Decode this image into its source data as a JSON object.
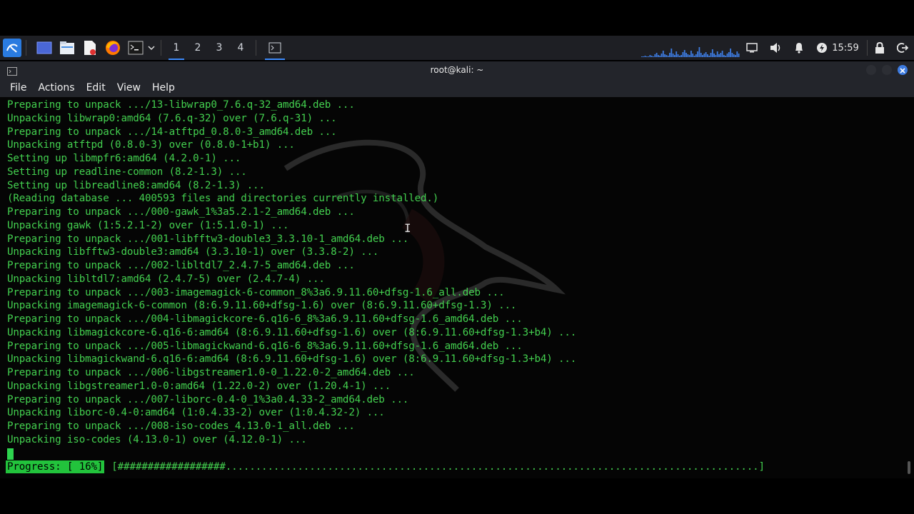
{
  "taskbar": {
    "workspaces": [
      "1",
      "2",
      "3",
      "4"
    ],
    "active_workspace": "1",
    "clock": "15:59",
    "icons": [
      "kali-menu-icon",
      "desktop-icon",
      "file-manager-icon",
      "text-editor-icon",
      "firefox-icon",
      "terminal-icon",
      "dropdown-chevron-icon",
      "terminal-task-icon",
      "cpu-graph",
      "display-icon",
      "volume-icon",
      "notification-bell-icon",
      "power-manager-icon",
      "lock-icon",
      "logout-icon"
    ]
  },
  "window": {
    "title": "root@kali: ~",
    "menu": [
      "File",
      "Actions",
      "Edit",
      "View",
      "Help"
    ]
  },
  "terminal": {
    "lines": [
      "Preparing to unpack .../13-libwrap0_7.6.q-32_amd64.deb ...",
      "Unpacking libwrap0:amd64 (7.6.q-32) over (7.6.q-31) ...",
      "Preparing to unpack .../14-atftpd_0.8.0-3_amd64.deb ...",
      "Unpacking atftpd (0.8.0-3) over (0.8.0-1+b1) ...",
      "Setting up libmpfr6:amd64 (4.2.0-1) ...",
      "Setting up readline-common (8.2-1.3) ...",
      "Setting up libreadline8:amd64 (8.2-1.3) ...",
      "(Reading database ... 400593 files and directories currently installed.)",
      "Preparing to unpack .../000-gawk_1%3a5.2.1-2_amd64.deb ...",
      "Unpacking gawk (1:5.2.1-2) over (1:5.1.0-1) ...",
      "Preparing to unpack .../001-libfftw3-double3_3.3.10-1_amd64.deb ...",
      "Unpacking libfftw3-double3:amd64 (3.3.10-1) over (3.3.8-2) ...",
      "Preparing to unpack .../002-libltdl7_2.4.7-5_amd64.deb ...",
      "Unpacking libltdl7:amd64 (2.4.7-5) over (2.4.7-4) ...",
      "Preparing to unpack .../003-imagemagick-6-common_8%3a6.9.11.60+dfsg-1.6_all.deb ...",
      "Unpacking imagemagick-6-common (8:6.9.11.60+dfsg-1.6) over (8:6.9.11.60+dfsg-1.3) ...",
      "Preparing to unpack .../004-libmagickcore-6.q16-6_8%3a6.9.11.60+dfsg-1.6_amd64.deb ...",
      "Unpacking libmagickcore-6.q16-6:amd64 (8:6.9.11.60+dfsg-1.6) over (8:6.9.11.60+dfsg-1.3+b4) ...",
      "Preparing to unpack .../005-libmagickwand-6.q16-6_8%3a6.9.11.60+dfsg-1.6_amd64.deb ...",
      "Unpacking libmagickwand-6.q16-6:amd64 (8:6.9.11.60+dfsg-1.6) over (8:6.9.11.60+dfsg-1.3+b4) ...",
      "Preparing to unpack .../006-libgstreamer1.0-0_1.22.0-2_amd64.deb ...",
      "Unpacking libgstreamer1.0-0:amd64 (1.22.0-2) over (1.20.4-1) ...",
      "Preparing to unpack .../007-liborc-0.4-0_1%3a0.4.33-2_amd64.deb ...",
      "Unpacking liborc-0.4-0:amd64 (1:0.4.33-2) over (1:0.4.32-2) ...",
      "Preparing to unpack .../008-iso-codes_4.13.0-1_all.deb ...",
      "Unpacking iso-codes (4.13.0-1) over (4.12.0-1) ..."
    ],
    "progress_label": "Progress: [ 16%]",
    "progress_bar": "[##################.........................................................................................]",
    "progress_fraction": 0.16
  }
}
